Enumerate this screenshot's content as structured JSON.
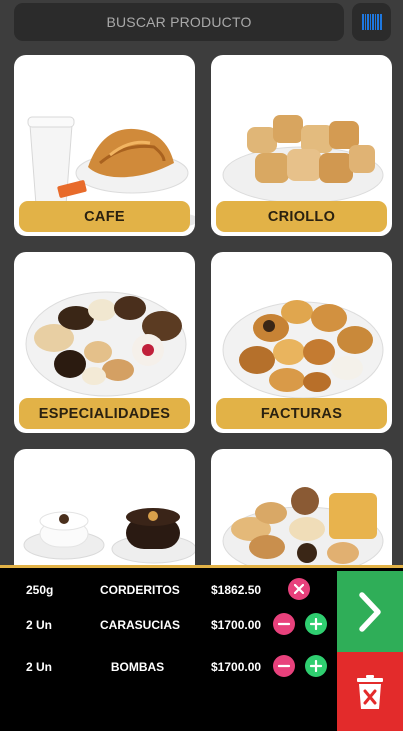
{
  "search": {
    "placeholder": "BUSCAR PRODUCTO",
    "icon": "barcode-icon"
  },
  "categories": [
    {
      "label": "CAFE"
    },
    {
      "label": "CRIOLLO"
    },
    {
      "label": "ESPECIALIDADES"
    },
    {
      "label": "FACTURAS"
    },
    {
      "label": ""
    },
    {
      "label": ""
    }
  ],
  "cart": {
    "items": [
      {
        "qty": "250g",
        "name": "CORDERITOS",
        "price": "$1862.50"
      },
      {
        "qty": "2 Un",
        "name": "CARASUCIAS",
        "price": "$1700.00"
      },
      {
        "qty": "2 Un",
        "name": "BOMBAS",
        "price": "$1700.00"
      }
    ]
  },
  "colors": {
    "background": "#3d3d3d",
    "accent": "#e2b247",
    "remove": "#e8417c",
    "add": "#2fce70",
    "next": "#2fae58",
    "delete": "#e32b2b"
  }
}
